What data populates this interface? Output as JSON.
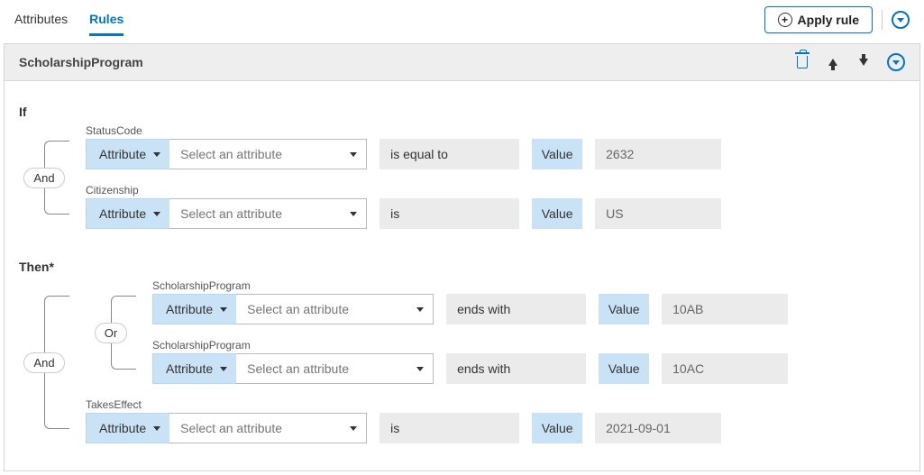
{
  "tabs": {
    "attributes": "Attributes",
    "rules": "Rules"
  },
  "actions": {
    "apply": "Apply rule"
  },
  "rule": {
    "title": "ScholarshipProgram"
  },
  "labels": {
    "if": "If",
    "then": "Then*",
    "and": "And",
    "or": "Or",
    "attribute": "Attribute",
    "value": "Value",
    "placeholder": "Select an attribute"
  },
  "if_conditions": [
    {
      "attr_label": "StatusCode",
      "operator": "is equal to",
      "value": "2632"
    },
    {
      "attr_label": "Citizenship",
      "operator": "is",
      "value": "US"
    }
  ],
  "then_group": {
    "or": [
      {
        "attr_label": "ScholarshipProgram",
        "operator": "ends with",
        "value": "10AB"
      },
      {
        "attr_label": "ScholarshipProgram",
        "operator": "ends with",
        "value": "10AC"
      }
    ],
    "last": {
      "attr_label": "TakesEffect",
      "operator": "is",
      "value": "2021-09-01"
    }
  }
}
